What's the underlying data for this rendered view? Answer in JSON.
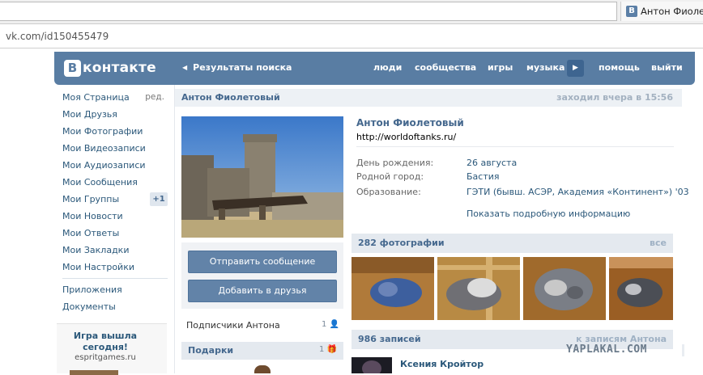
{
  "browser": {
    "tab_title": "Антон Фиолетовый",
    "url": "vk.com/id150455479"
  },
  "header": {
    "logo_letter": "В",
    "logo_text": "контакте",
    "back_label": "Результаты поиска",
    "nav": [
      "люди",
      "сообщества",
      "игры",
      "музыка",
      "помощь",
      "выйти"
    ],
    "brand_color": "#597da3"
  },
  "sidebar": {
    "items": [
      {
        "label": "Моя Страница",
        "extra": "ред."
      },
      {
        "label": "Мои Друзья"
      },
      {
        "label": "Мои Фотографии"
      },
      {
        "label": "Мои Видеозаписи"
      },
      {
        "label": "Мои Аудиозаписи"
      },
      {
        "label": "Мои Сообщения"
      },
      {
        "label": "Мои Группы",
        "badge": "+1"
      },
      {
        "label": "Мои Новости"
      },
      {
        "label": "Мои Ответы"
      },
      {
        "label": "Мои Закладки"
      },
      {
        "label": "Мои Настройки"
      }
    ],
    "extra_items": [
      "Приложения",
      "Документы"
    ],
    "ad": {
      "title": "Игра вышла сегодня!",
      "domain": "espritgames.ru"
    }
  },
  "profile": {
    "name_bar": "Антон Фиолетовый",
    "last_seen": "заходил вчера в 15:56",
    "name": "Антон Фиолетовый",
    "status": "http://worldoftanks.ru/",
    "info": [
      {
        "label": "День рождения:",
        "value": "26 августа"
      },
      {
        "label": "Родной город:",
        "value": "Бастия"
      },
      {
        "label": "Образование:",
        "value": "ГЭТИ (бывш. АСЭР, Академия «Континент») '03"
      }
    ],
    "more_info": "Показать подробную информацию",
    "send_message": "Отправить сообщение",
    "add_friend": "Добавить в друзья",
    "subscribers": "Подписчики Антона",
    "subscribers_count": "1",
    "gifts": "Подарки",
    "gifts_count": "1"
  },
  "photos": {
    "title": "282 фотографии",
    "all": "все"
  },
  "wall": {
    "title": "986 записей",
    "link": "к записям Антона",
    "first_post_author": "Ксения Кройтор"
  },
  "watermark": "YAPLAKAL.COM"
}
